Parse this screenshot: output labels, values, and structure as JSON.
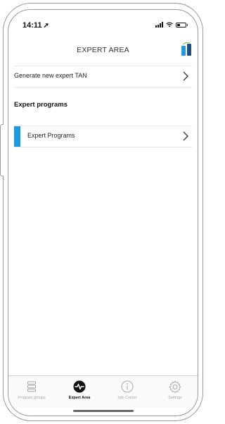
{
  "status_bar": {
    "time": "14:11",
    "location_glyph": "➚"
  },
  "header": {
    "title": "EXPERT AREA"
  },
  "rows": {
    "generate_tan": {
      "label": "Generate new expert TAN"
    },
    "section_title": "Expert programs",
    "expert_programs": {
      "label": "Expert Programs"
    }
  },
  "tabbar": {
    "tabs": [
      {
        "label": "Program groups",
        "icon": "list-icon",
        "active": false
      },
      {
        "label": "Expert Area",
        "icon": "pulse-icon",
        "active": true
      },
      {
        "label": "Info Center",
        "icon": "info-icon",
        "active": false
      },
      {
        "label": "Settings",
        "icon": "gear-icon",
        "active": false
      }
    ]
  },
  "colors": {
    "accent": "#1a9be0",
    "text": "#222222",
    "tab_inactive": "#a8a8a8",
    "frame": "#9a9a9a"
  }
}
